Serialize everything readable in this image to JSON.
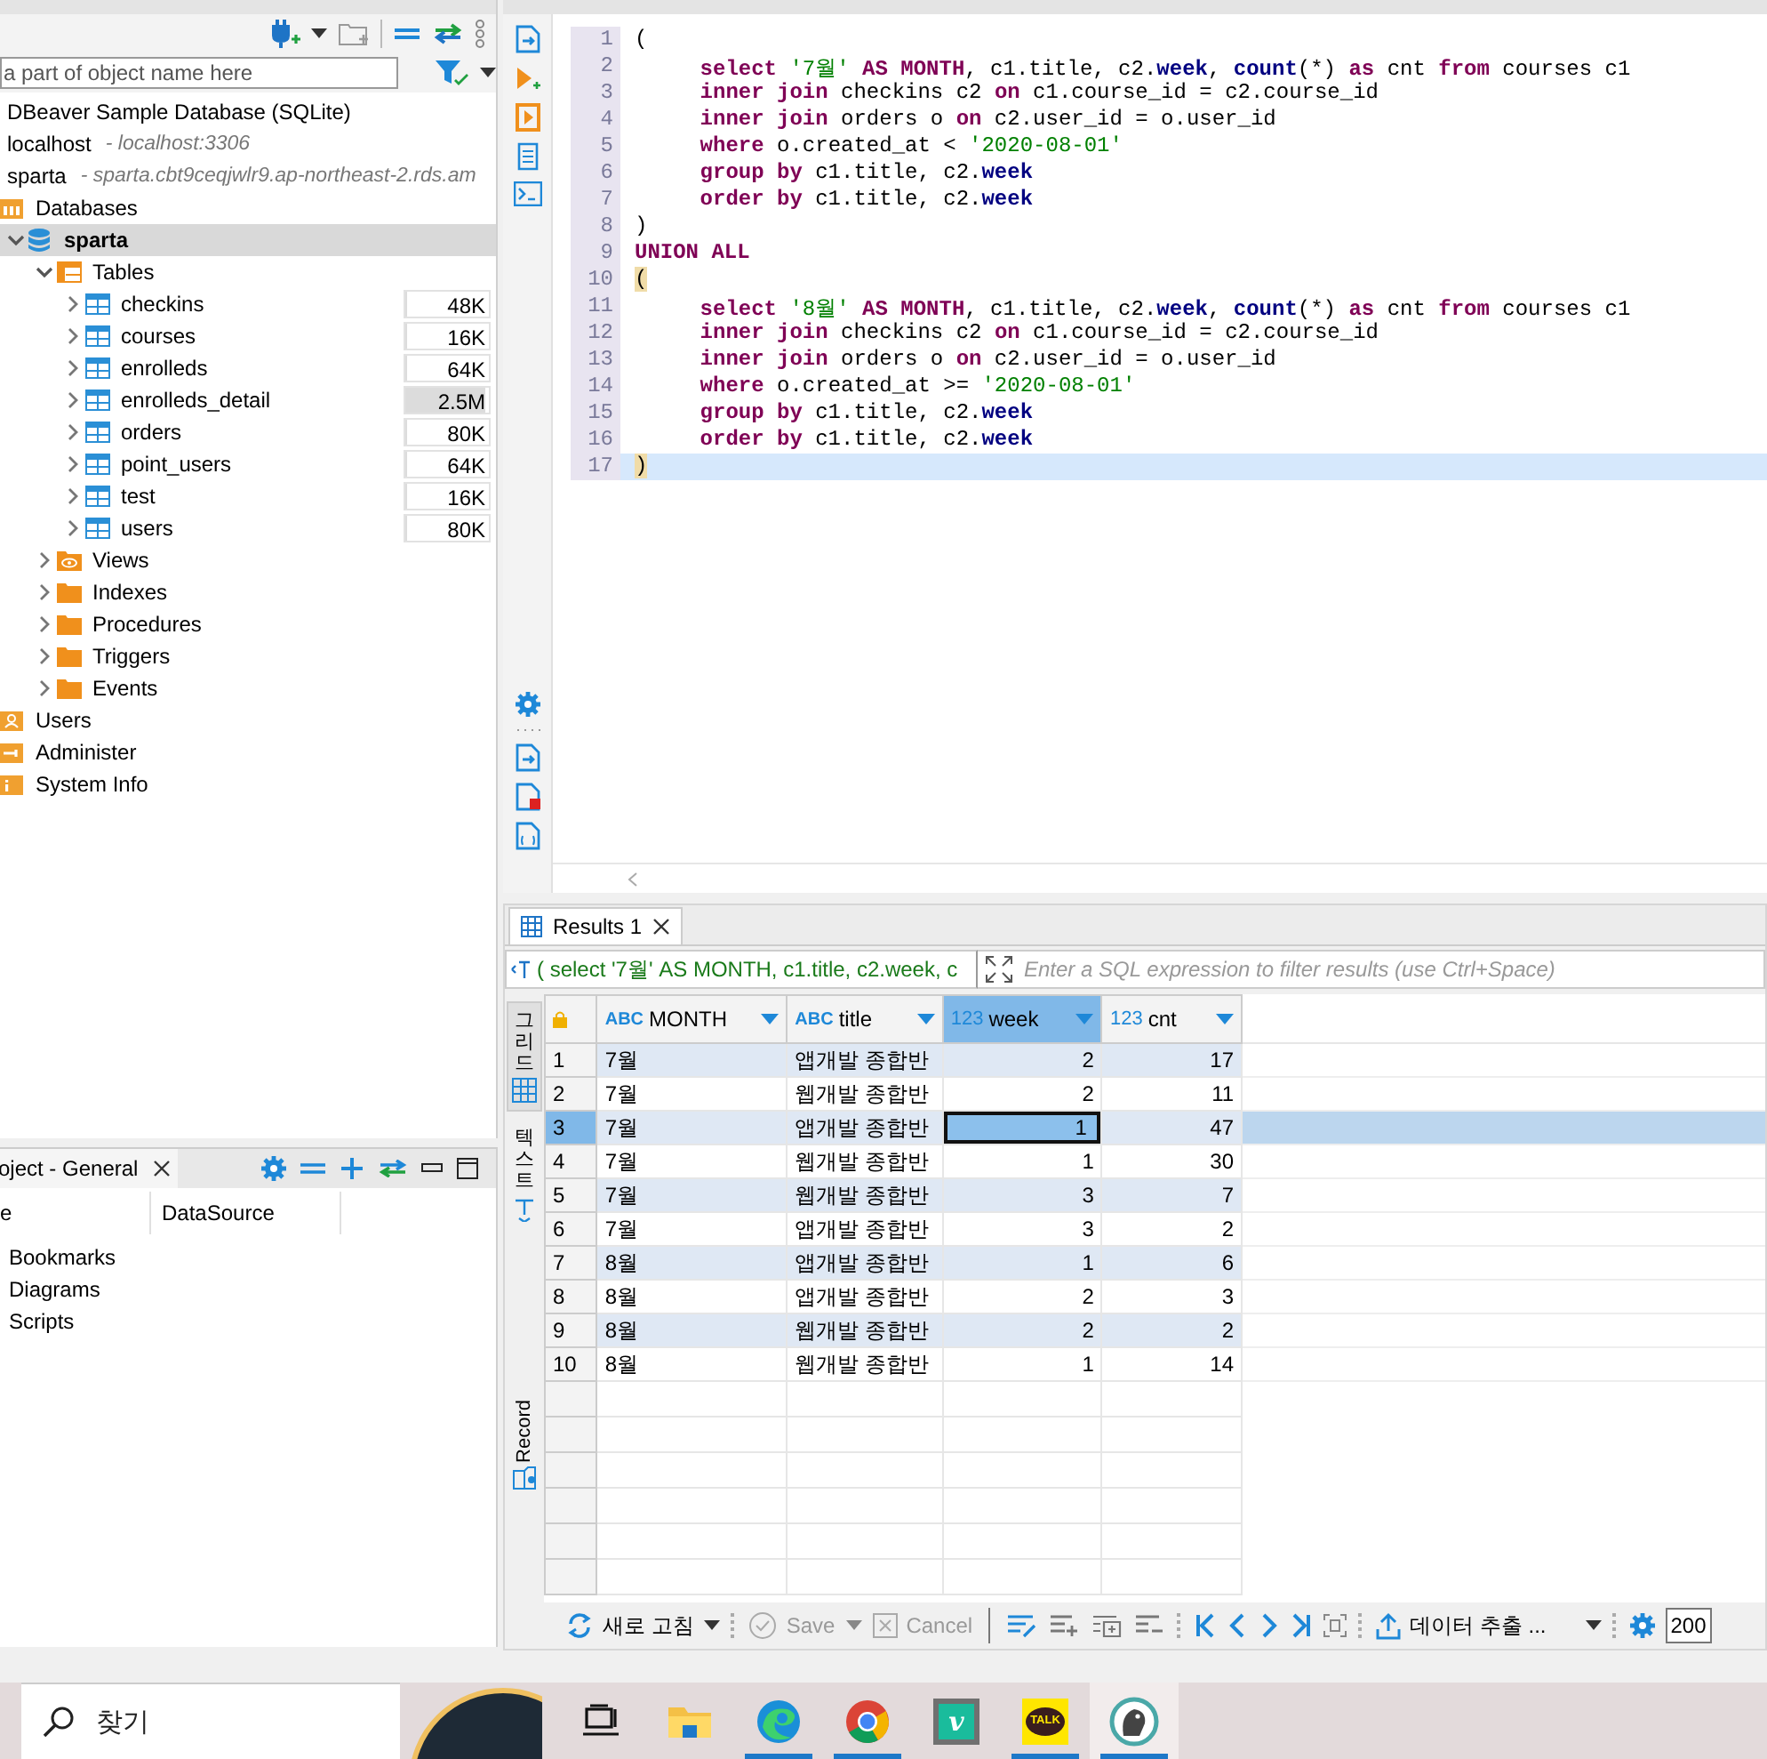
{
  "navigator": {
    "filter_placeholder": "a part of object name here",
    "tree": [
      {
        "label": "DBeaver Sample Database (SQLite)"
      },
      {
        "label": "localhost",
        "detail": "- localhost:3306"
      },
      {
        "label": "sparta",
        "detail": "- sparta.cbt9ceqjwlr9.ap-northeast-2.rds.am",
        "children": [
          {
            "kind": "databases",
            "label": "Databases",
            "children": [
              {
                "kind": "database",
                "label": "sparta",
                "expanded": true,
                "selected": true,
                "children": [
                  {
                    "kind": "tables",
                    "label": "Tables",
                    "expanded": true,
                    "selected": false,
                    "children": [
                      {
                        "kind": "table",
                        "label": "checkins",
                        "expanded": false,
                        "selected": false,
                        "size": "48K",
                        "level": 0.02
                      },
                      {
                        "kind": "table",
                        "label": "courses",
                        "expanded": false,
                        "selected": false,
                        "size": "16K",
                        "level": 0.01
                      },
                      {
                        "kind": "table",
                        "label": "enrolleds",
                        "expanded": false,
                        "selected": false,
                        "size": "64K",
                        "level": 0.02
                      },
                      {
                        "kind": "table",
                        "label": "enrolleds_detail",
                        "expanded": false,
                        "selected": false,
                        "size": "2.5M",
                        "level": 0.95
                      },
                      {
                        "kind": "table",
                        "label": "orders",
                        "expanded": false,
                        "selected": false,
                        "size": "80K",
                        "level": 0.03
                      },
                      {
                        "kind": "table",
                        "label": "point_users",
                        "expanded": false,
                        "selected": false,
                        "size": "64K",
                        "level": 0.02
                      },
                      {
                        "kind": "table",
                        "label": "test",
                        "expanded": false,
                        "selected": false,
                        "size": "16K",
                        "level": 0.01
                      },
                      {
                        "kind": "table",
                        "label": "users",
                        "expanded": false,
                        "selected": false,
                        "size": "80K",
                        "level": 0.03
                      }
                    ]
                  },
                  {
                    "kind": "views",
                    "label": "Views",
                    "expanded": false,
                    "selected": false
                  },
                  {
                    "kind": "folder",
                    "label": "Indexes",
                    "expanded": false,
                    "selected": false
                  },
                  {
                    "kind": "folder",
                    "label": "Procedures",
                    "expanded": false,
                    "selected": false
                  },
                  {
                    "kind": "folder",
                    "label": "Triggers",
                    "expanded": false,
                    "selected": false
                  },
                  {
                    "kind": "folder",
                    "label": "Events",
                    "expanded": false,
                    "selected": false
                  }
                ]
              }
            ]
          },
          {
            "kind": "users",
            "label": "Users"
          },
          {
            "kind": "admin",
            "label": "Administer"
          },
          {
            "kind": "info",
            "label": "System Info"
          }
        ]
      }
    ]
  },
  "editor": {
    "lines": [
      {
        "number": "1",
        "indent": false,
        "current": false,
        "tokens": [
          {
            "kind": "plain",
            "text": "("
          }
        ]
      },
      {
        "number": "2",
        "indent": true,
        "current": false,
        "tokens": [
          {
            "kind": "keyword",
            "text": "select"
          },
          {
            "kind": "string",
            "text": " '7월' "
          },
          {
            "kind": "keyword",
            "text": "AS MONTH"
          },
          {
            "kind": "plain",
            "text": ", c1.title, c2."
          },
          {
            "kind": "name",
            "text": "week"
          },
          {
            "kind": "plain",
            "text": ", "
          },
          {
            "kind": "name",
            "text": "count"
          },
          {
            "kind": "plain",
            "text": "(*) "
          },
          {
            "kind": "keyword",
            "text": "as"
          },
          {
            "kind": "plain",
            "text": " cnt "
          },
          {
            "kind": "keyword",
            "text": "from"
          },
          {
            "kind": "plain",
            "text": " courses c1"
          }
        ]
      },
      {
        "number": "3",
        "indent": true,
        "current": false,
        "tokens": [
          {
            "kind": "keyword",
            "text": "inner join"
          },
          {
            "kind": "plain",
            "text": " checkins c2 "
          },
          {
            "kind": "keyword",
            "text": "on"
          },
          {
            "kind": "plain",
            "text": " c1.course_id = c2.course_id"
          }
        ]
      },
      {
        "number": "4",
        "indent": true,
        "current": false,
        "tokens": [
          {
            "kind": "keyword",
            "text": "inner join"
          },
          {
            "kind": "plain",
            "text": " orders o "
          },
          {
            "kind": "keyword",
            "text": "on"
          },
          {
            "kind": "plain",
            "text": " c2.user_id = o.user_id"
          }
        ]
      },
      {
        "number": "5",
        "indent": true,
        "current": false,
        "tokens": [
          {
            "kind": "keyword",
            "text": "where"
          },
          {
            "kind": "plain",
            "text": " o.created_at < "
          },
          {
            "kind": "string",
            "text": "'2020-08-01'"
          }
        ]
      },
      {
        "number": "6",
        "indent": true,
        "current": false,
        "tokens": [
          {
            "kind": "keyword",
            "text": "group by"
          },
          {
            "kind": "plain",
            "text": " c1.title, c2."
          },
          {
            "kind": "name",
            "text": "week"
          }
        ]
      },
      {
        "number": "7",
        "indent": true,
        "current": false,
        "tokens": [
          {
            "kind": "keyword",
            "text": "order by"
          },
          {
            "kind": "plain",
            "text": " c1.title, c2."
          },
          {
            "kind": "name",
            "text": "week"
          }
        ]
      },
      {
        "number": "8",
        "indent": false,
        "current": false,
        "tokens": [
          {
            "kind": "plain",
            "text": ")"
          }
        ]
      },
      {
        "number": "9",
        "indent": false,
        "current": false,
        "tokens": [
          {
            "kind": "keyword",
            "text": "UNION ALL"
          }
        ]
      },
      {
        "number": "10",
        "indent": false,
        "current": false,
        "tokens": [
          {
            "kind": "bracket",
            "text": "("
          }
        ]
      },
      {
        "number": "11",
        "indent": true,
        "current": false,
        "tokens": [
          {
            "kind": "keyword",
            "text": "select"
          },
          {
            "kind": "string",
            "text": " '8월' "
          },
          {
            "kind": "keyword",
            "text": "AS MONTH"
          },
          {
            "kind": "plain",
            "text": ", c1.title, c2."
          },
          {
            "kind": "name",
            "text": "week"
          },
          {
            "kind": "plain",
            "text": ", "
          },
          {
            "kind": "name",
            "text": "count"
          },
          {
            "kind": "plain",
            "text": "(*) "
          },
          {
            "kind": "keyword",
            "text": "as"
          },
          {
            "kind": "plain",
            "text": " cnt "
          },
          {
            "kind": "keyword",
            "text": "from"
          },
          {
            "kind": "plain",
            "text": " courses c1"
          }
        ]
      },
      {
        "number": "12",
        "indent": true,
        "current": false,
        "tokens": [
          {
            "kind": "keyword",
            "text": "inner join"
          },
          {
            "kind": "plain",
            "text": " checkins c2 "
          },
          {
            "kind": "keyword",
            "text": "on"
          },
          {
            "kind": "plain",
            "text": " c1.course_id = c2.course_id"
          }
        ]
      },
      {
        "number": "13",
        "indent": true,
        "current": false,
        "tokens": [
          {
            "kind": "keyword",
            "text": "inner join"
          },
          {
            "kind": "plain",
            "text": " orders o "
          },
          {
            "kind": "keyword",
            "text": "on"
          },
          {
            "kind": "plain",
            "text": " c2.user_id = o.user_id"
          }
        ]
      },
      {
        "number": "14",
        "indent": true,
        "current": false,
        "tokens": [
          {
            "kind": "keyword",
            "text": "where"
          },
          {
            "kind": "plain",
            "text": " o.created_at >= "
          },
          {
            "kind": "string",
            "text": "'2020-08-01'"
          }
        ]
      },
      {
        "number": "15",
        "indent": true,
        "current": false,
        "tokens": [
          {
            "kind": "keyword",
            "text": "group by"
          },
          {
            "kind": "plain",
            "text": " c1.title, c2."
          },
          {
            "kind": "name",
            "text": "week"
          }
        ]
      },
      {
        "number": "16",
        "indent": true,
        "current": false,
        "tokens": [
          {
            "kind": "keyword",
            "text": "order by"
          },
          {
            "kind": "plain",
            "text": " c1.title, c2."
          },
          {
            "kind": "name",
            "text": "week"
          }
        ]
      },
      {
        "number": "17",
        "indent": false,
        "current": true,
        "tokens": [
          {
            "kind": "bracket",
            "text": ")"
          }
        ]
      }
    ]
  },
  "project": {
    "tab": "oject - General",
    "columns": [
      "e",
      "DataSource"
    ],
    "items": [
      "Bookmarks",
      "Diagrams",
      "Scripts"
    ]
  },
  "results": {
    "tab": "Results 1",
    "query": "( select '7월' AS MONTH, c1.title, c2.week, c",
    "filter_placeholder": "Enter a SQL expression to filter results (use Ctrl+Space)",
    "side_tabs": [
      {
        "kind": "grid",
        "label": "그리드",
        "selected": true
      },
      {
        "kind": "text",
        "label": "텍스트",
        "selected": false
      },
      {
        "kind": "record",
        "label": "Record",
        "selected": false
      }
    ],
    "columns": [
      {
        "kind": "string",
        "type": "ABC",
        "name": "MONTH",
        "selected": false
      },
      {
        "kind": "string",
        "type": "ABC",
        "name": "title",
        "selected": false
      },
      {
        "kind": "number",
        "type": "123",
        "name": "week",
        "selected": true
      },
      {
        "kind": "number",
        "type": "123",
        "name": "cnt",
        "selected": false
      }
    ],
    "rows": [
      {
        "number": "1",
        "selected": false,
        "cells": [
          "7월",
          "앱개발 종합반",
          "2",
          "17"
        ]
      },
      {
        "number": "2",
        "selected": false,
        "cells": [
          "7월",
          "웹개발 종합반",
          "2",
          "11"
        ]
      },
      {
        "number": "3",
        "selected": true,
        "cells": [
          "7월",
          "앱개발 종합반",
          "1",
          "47"
        ]
      },
      {
        "number": "4",
        "selected": false,
        "cells": [
          "7월",
          "웹개발 종합반",
          "1",
          "30"
        ]
      },
      {
        "number": "5",
        "selected": false,
        "cells": [
          "7월",
          "웹개발 종합반",
          "3",
          "7"
        ]
      },
      {
        "number": "6",
        "selected": false,
        "cells": [
          "7월",
          "앱개발 종합반",
          "3",
          "2"
        ]
      },
      {
        "number": "7",
        "selected": false,
        "cells": [
          "8월",
          "앱개발 종합반",
          "1",
          "6"
        ]
      },
      {
        "number": "8",
        "selected": false,
        "cells": [
          "8월",
          "앱개발 종합반",
          "2",
          "3"
        ]
      },
      {
        "number": "9",
        "selected": false,
        "cells": [
          "8월",
          "웹개발 종합반",
          "2",
          "2"
        ]
      },
      {
        "number": "10",
        "selected": false,
        "cells": [
          "8월",
          "웹개발 종합반",
          "1",
          "14"
        ]
      }
    ],
    "toolbar": {
      "refresh": "새로 고침",
      "save": {
        "label": "Save",
        "disabled": true
      },
      "cancel": {
        "label": "Cancel",
        "disabled": true
      },
      "export": "데이터 추출 ...",
      "fetch_size": "200"
    }
  },
  "taskbar": {
    "search_placeholder": "찾기",
    "apps": [
      {
        "kind": "task-view",
        "running": false,
        "active": false
      },
      {
        "kind": "explorer",
        "running": false,
        "active": false
      },
      {
        "kind": "edge",
        "running": true,
        "active": false
      },
      {
        "kind": "chrome",
        "running": true,
        "active": false
      },
      {
        "kind": "letter",
        "label": "v",
        "running": false,
        "active": false
      },
      {
        "kind": "kakao",
        "label": "TALK",
        "running": true,
        "active": false
      },
      {
        "kind": "dbeaver",
        "running": true,
        "active": true
      }
    ]
  }
}
